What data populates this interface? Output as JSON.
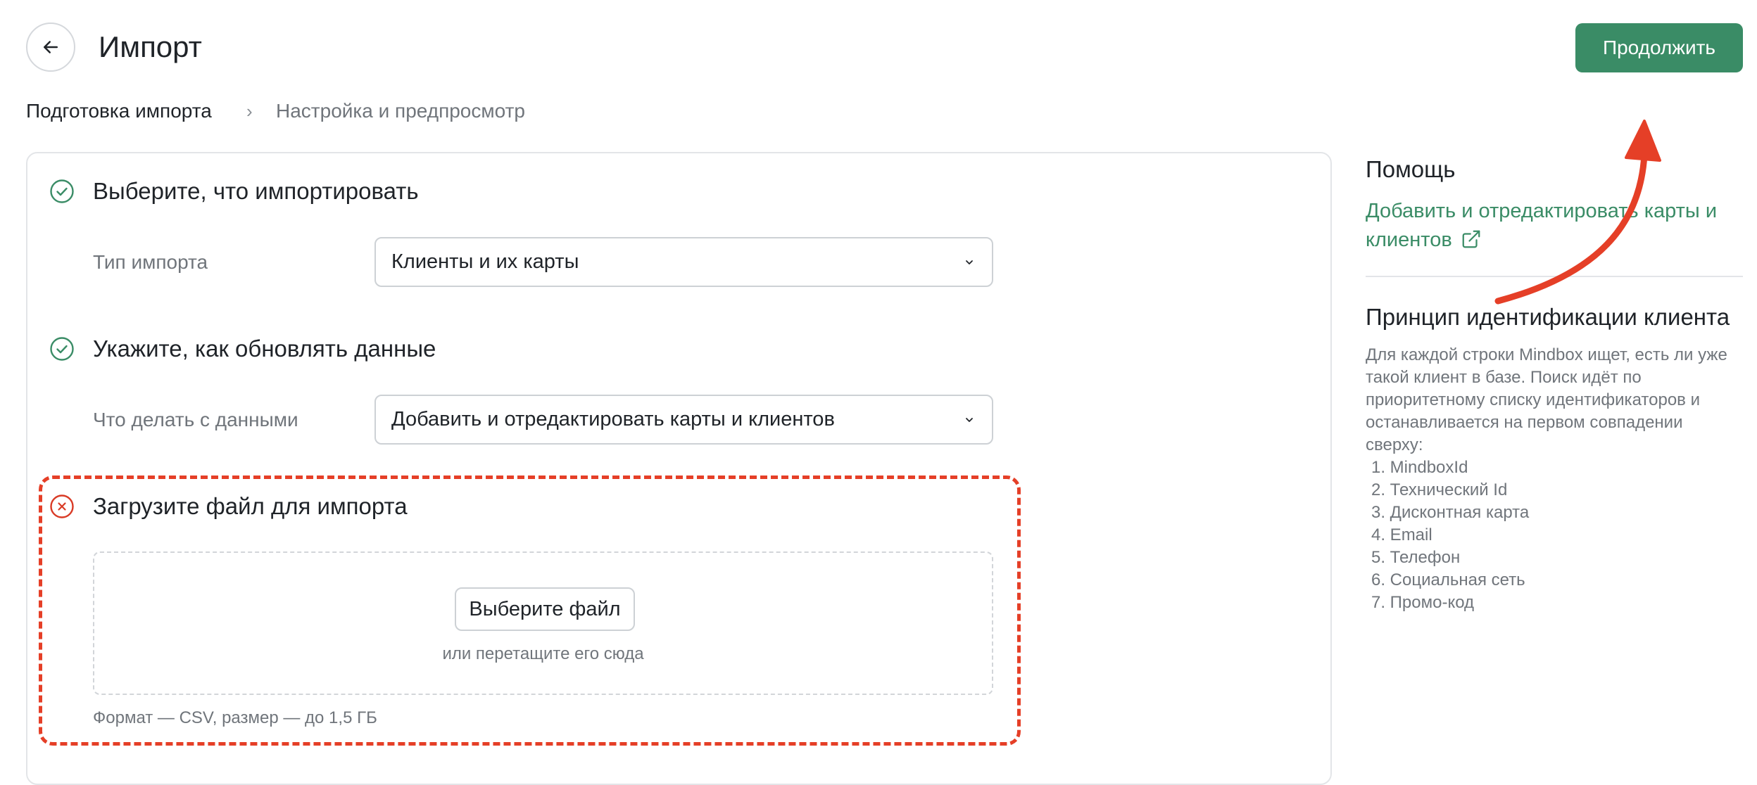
{
  "header": {
    "title": "Импорт",
    "continue_label": "Продолжить",
    "accent_color": "#3a8c66"
  },
  "breadcrumb": {
    "items": [
      "Подготовка импорта",
      "Настройка и предпросмотр"
    ],
    "separator": "›"
  },
  "steps": [
    {
      "title": "Выберите, что импортировать",
      "status": "done",
      "field_label": "Тип импорта",
      "select_value": "Клиенты и их карты"
    },
    {
      "title": "Укажите, как обновлять данные",
      "status": "done",
      "field_label": "Что делать с данными",
      "select_value": "Добавить и отредактировать карты и клиентов"
    },
    {
      "title": "Загрузите файл для импорта",
      "status": "error",
      "upload_button": "Выберите файл",
      "drop_hint": "или перетащите его сюда",
      "format_hint": "Формат — CSV, размер — до 1,5 ГБ"
    }
  ],
  "help": {
    "title": "Помощь",
    "link_text": "Добавить и отредактировать карты и клиентов",
    "link_icon": "external-link-icon"
  },
  "principle": {
    "title": "Принцип идентификации клиента",
    "text": "Для каждой строки Mindbox ищет, есть ли уже такой клиент в базе. Поиск идёт по приоритетному списку идентификаторов и останавливается на первом совпадении сверху:",
    "identifiers": [
      "1. MindboxId",
      "2. Технический Id",
      "3. Дисконтная карта",
      "4. Email",
      "5. Телефон",
      "6. Социальная сеть",
      "7. Промо-код"
    ]
  },
  "annotation": {
    "color": "#e53f27"
  }
}
